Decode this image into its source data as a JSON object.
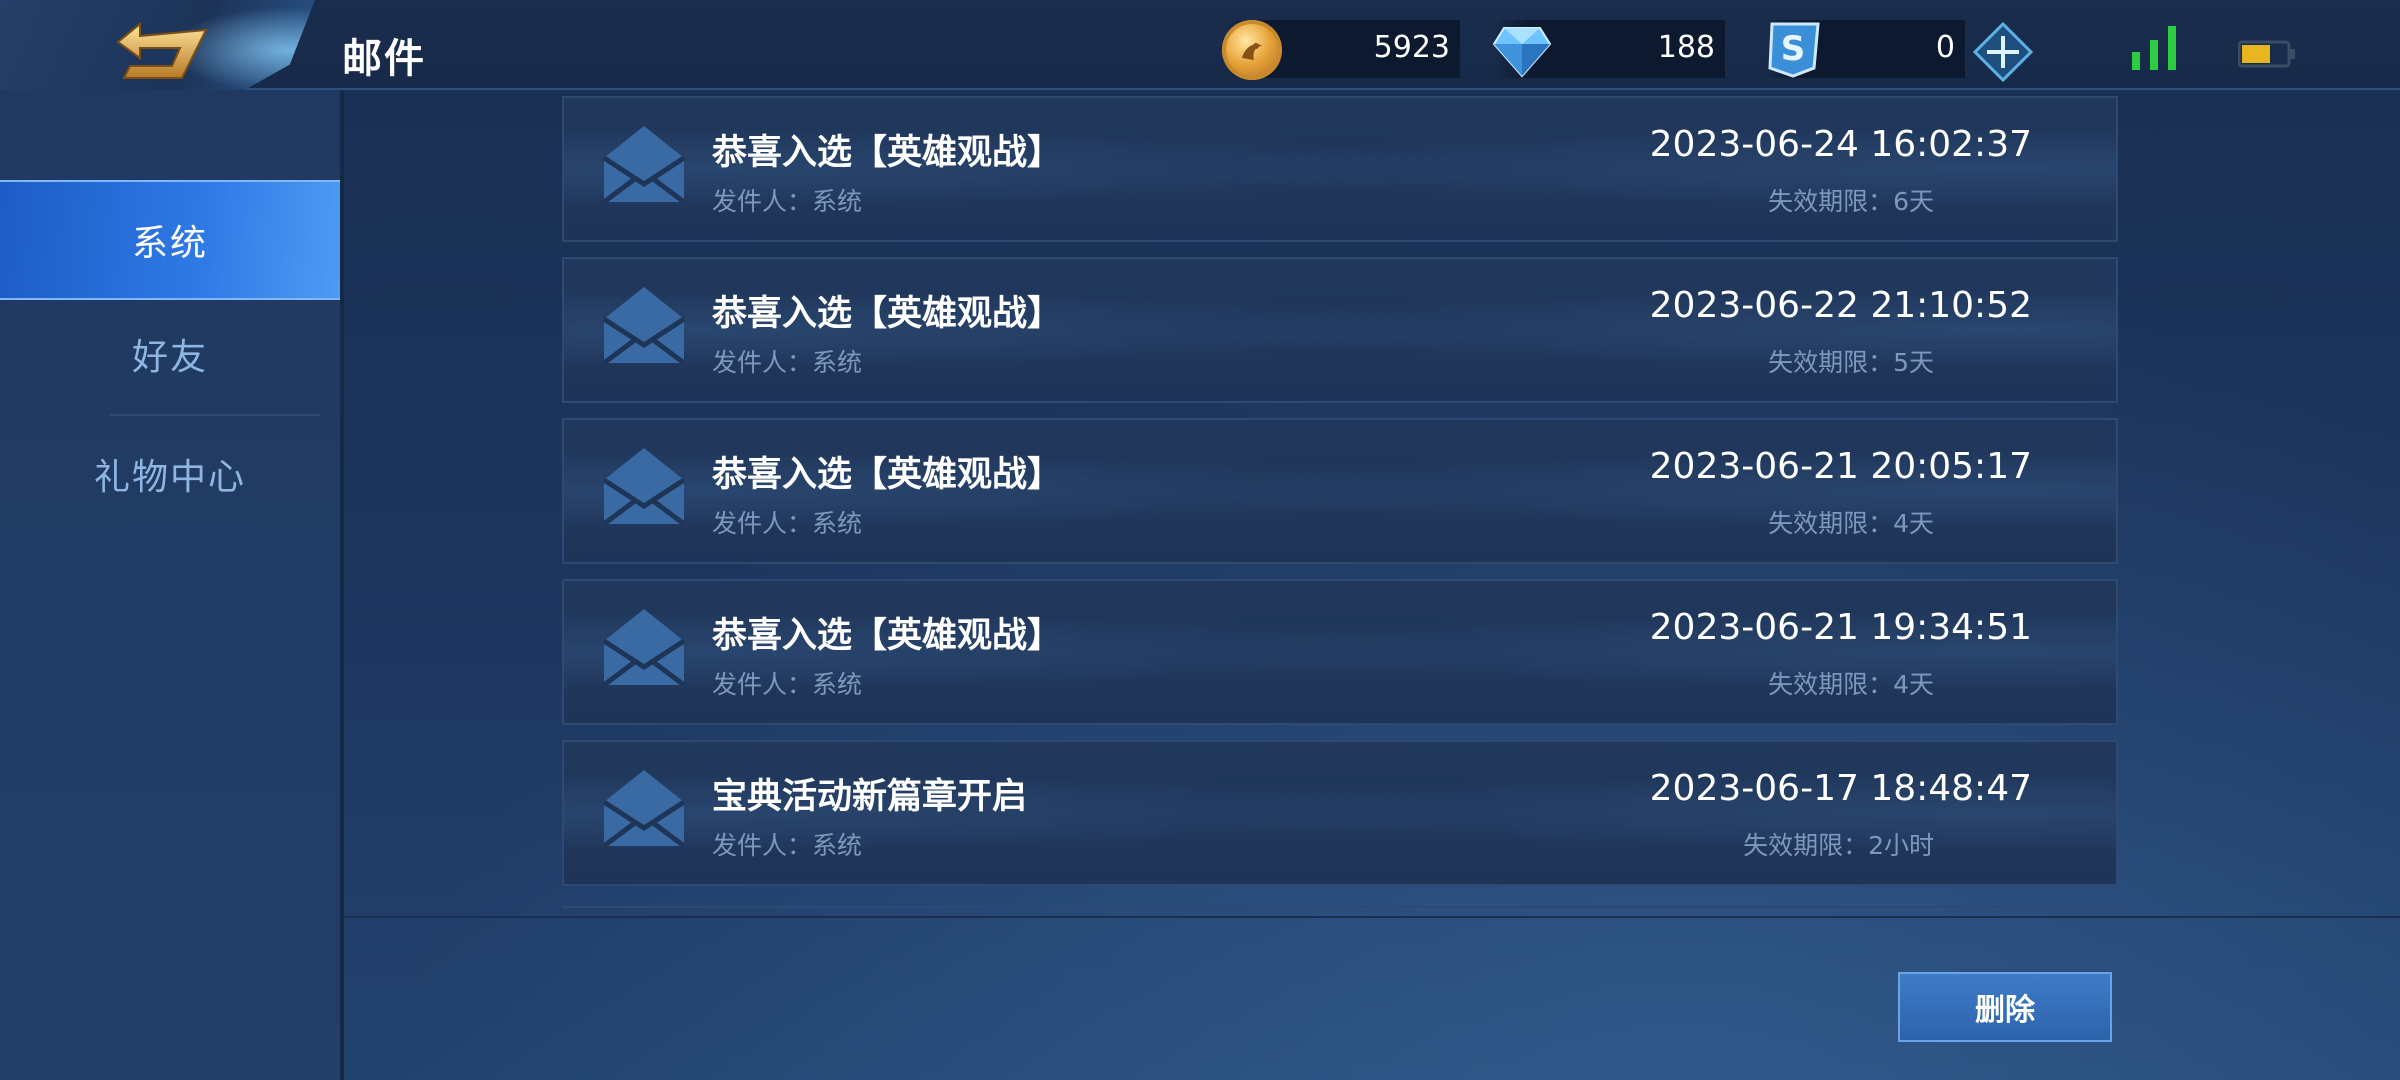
{
  "header": {
    "title": "邮件",
    "back_icon": "back-arrow-icon"
  },
  "currencies": {
    "gold": {
      "value": "5923",
      "icon": "gold-coin-icon"
    },
    "diamond": {
      "value": "188",
      "icon": "diamond-icon"
    },
    "coupon": {
      "value": "0",
      "icon": "coupon-icon"
    }
  },
  "status": {
    "signal_icon": "signal-bars-icon",
    "battery_icon": "battery-icon"
  },
  "sidebar": {
    "items": [
      {
        "label": "系统",
        "active": true
      },
      {
        "label": "好友",
        "active": false
      },
      {
        "label": "礼物中心",
        "active": false
      }
    ]
  },
  "mails": [
    {
      "title": "恭喜入选【英雄观战】",
      "sender": "发件人：系统",
      "date": "2023-06-24 16:02:37",
      "expire": "失效期限：6天"
    },
    {
      "title": "恭喜入选【英雄观战】",
      "sender": "发件人：系统",
      "date": "2023-06-22 21:10:52",
      "expire": "失效期限：5天"
    },
    {
      "title": "恭喜入选【英雄观战】",
      "sender": "发件人：系统",
      "date": "2023-06-21 20:05:17",
      "expire": "失效期限：4天"
    },
    {
      "title": "恭喜入选【英雄观战】",
      "sender": "发件人：系统",
      "date": "2023-06-21 19:34:51",
      "expire": "失效期限：4天"
    },
    {
      "title": "宝典活动新篇章开启",
      "sender": "发件人：系统",
      "date": "2023-06-17 18:48:47",
      "expire": "失效期限：2小时"
    }
  ],
  "footer": {
    "delete_label": "删除"
  },
  "colors": {
    "background": "#1c3257",
    "sidebar_active": "#2f7ae6",
    "signal_green": "#2ecc40",
    "battery_yellow": "#e8b720",
    "muted_text": "#7e98bd"
  }
}
